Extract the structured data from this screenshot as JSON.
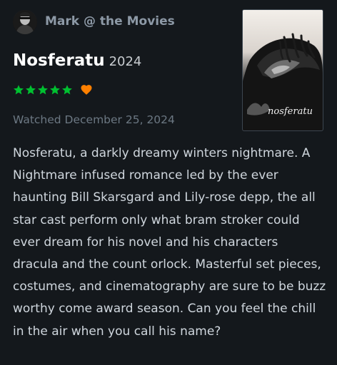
{
  "user": {
    "name": "Mark @ the Movies",
    "avatar_icon": "avatar-photo"
  },
  "film": {
    "title": "Nosferatu",
    "year": "2024",
    "poster_text": "nosferatu"
  },
  "rating": {
    "stars": 5,
    "max_stars": 5,
    "liked": true,
    "star_color": "#00c030",
    "heart_color": "#ff8000"
  },
  "watched": {
    "label": "Watched December 25, 2024"
  },
  "review": {
    "text": "Nosferatu, a darkly dreamy winters nightmare. A Nightmare infused romance led by the ever haunting Bill Skarsgard and Lily-rose depp, the all star cast perform only what bram stroker could ever dream for his novel and his characters dracula and the count orlock. Masterful set pieces, costumes, and cinematography are sure to be buzz worthy come award season. Can you feel the chill in the air when you call his name?"
  },
  "colors": {
    "background": "#14181c",
    "username": "#8d99a6",
    "muted": "#6c7883",
    "body_text": "#cfd6dd"
  }
}
